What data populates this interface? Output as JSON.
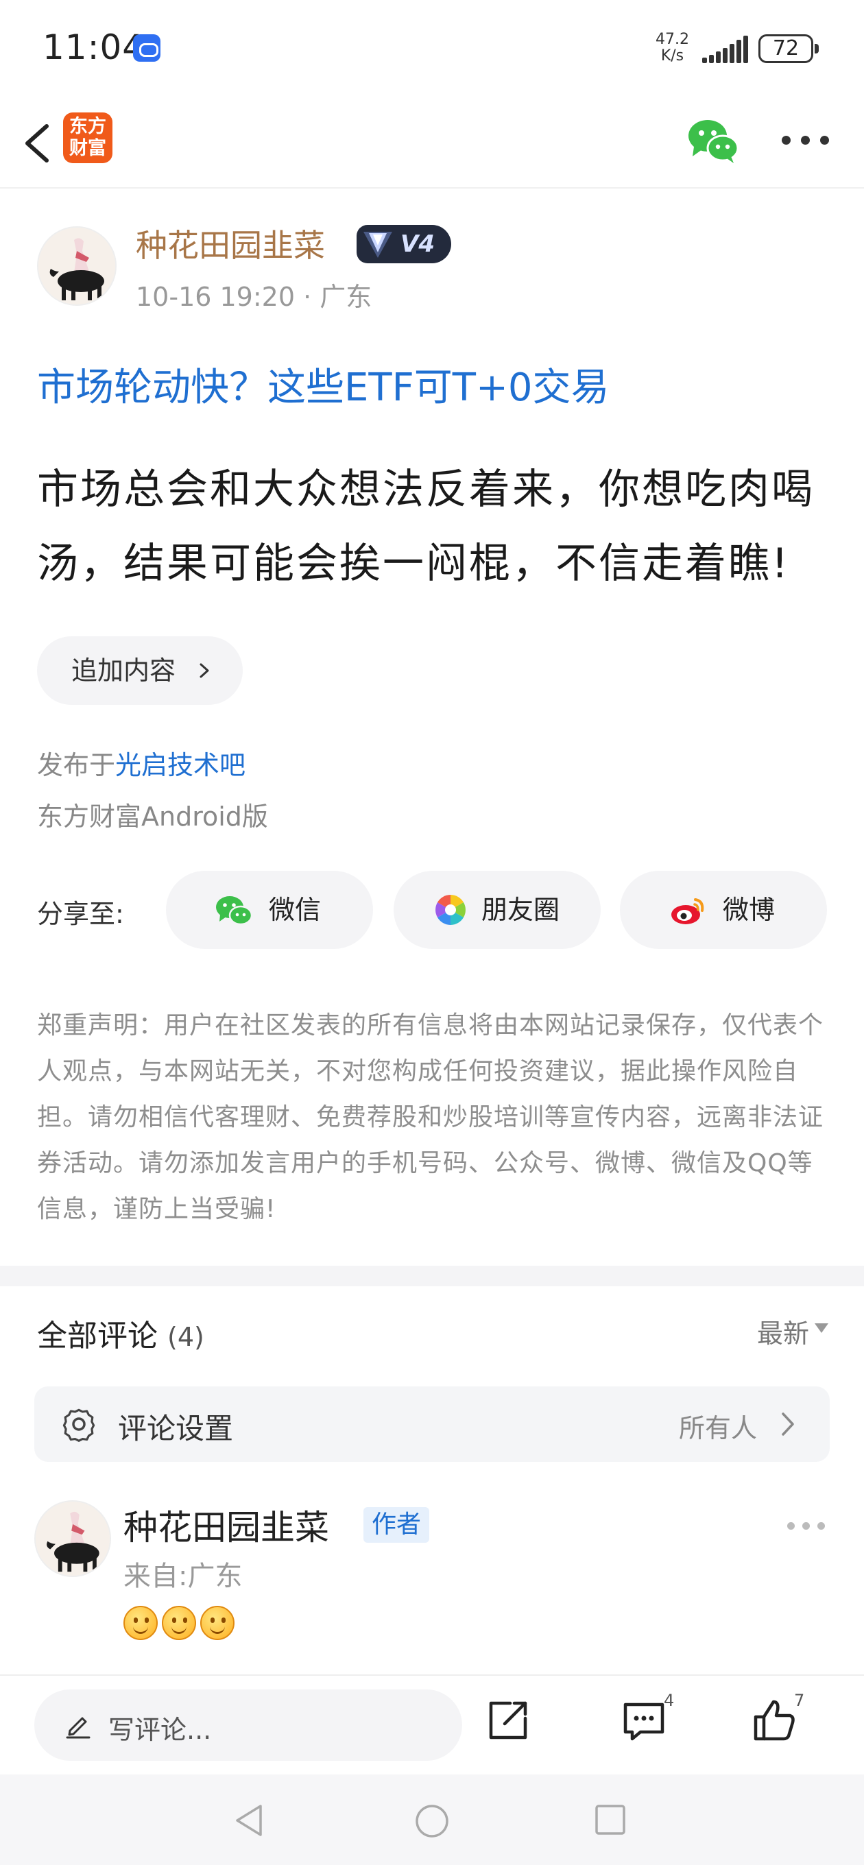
{
  "status_bar": {
    "time": "11:04",
    "net_speed_value": "47.2",
    "net_speed_unit": "K/s",
    "battery": "72"
  },
  "nav": {
    "app_logo_line1": "东方",
    "app_logo_line2": "财富"
  },
  "post": {
    "author": "种花田园韭菜",
    "level": "V4",
    "meta": "10-16 19:20 · 广东",
    "title": "市场轮动快？这些ETF可T+0交易",
    "body": "市场总会和大众想法反着来，你想吃肉喝汤，结果可能会挨一闷棍，不信走着瞧!",
    "append_label": "追加内容",
    "published_prefix": "发布于",
    "published_bar": "光启技术吧",
    "client": "东方财富Android版"
  },
  "share": {
    "label": "分享至:",
    "wechat": "微信",
    "moments": "朋友圈",
    "weibo": "微博"
  },
  "disclaimer": "郑重声明：用户在社区发表的所有信息将由本网站记录保存，仅代表个人观点，与本网站无关，不对您构成任何投资建议，据此操作风险自担。请勿相信代客理财、免费荐股和炒股培训等宣传内容，远离非法证券活动。请勿添加发言用户的手机号码、公众号、微博、微信及QQ等信息，谨防上当受骗!",
  "comments": {
    "title": "全部评论",
    "count": "(4)",
    "sort": "最新",
    "settings_label": "评论设置",
    "settings_value": "所有人",
    "items": [
      {
        "author": "种花田园韭菜",
        "tag": "作者",
        "from": "来自:广东"
      }
    ]
  },
  "bottom_bar": {
    "input_placeholder": "写评论...",
    "comment_count": "4",
    "like_count": "7"
  },
  "colors": {
    "link_blue": "#1f6fd1",
    "author_gold": "#a87648",
    "brand_orange": "#f05a1a",
    "wechat_green": "#3cbf4a"
  }
}
